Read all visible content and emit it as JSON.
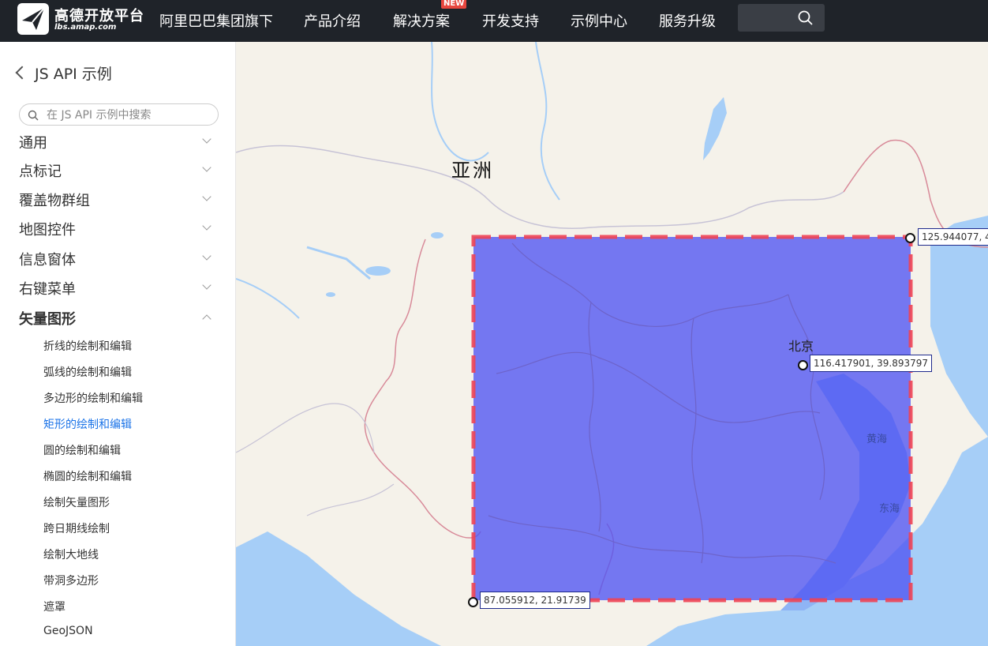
{
  "brand": {
    "title": "高德开放平台",
    "subtitle": "lbs.amap.com"
  },
  "nav": {
    "items": [
      "阿里巴巴集团旗下",
      "产品介绍",
      "解决方案",
      "开发支持",
      "示例中心",
      "服务升级"
    ],
    "badge": "NEW",
    "search_value": ""
  },
  "sidebar": {
    "back_label": "JS API 示例",
    "search_placeholder": "在 JS API 示例中搜索",
    "partial_category": "通用",
    "categories": [
      "点标记",
      "覆盖物群组",
      "地图控件",
      "信息窗体",
      "右键菜单",
      "矢量图形"
    ],
    "subitems": [
      "折线的绘制和编辑",
      "弧线的绘制和编辑",
      "多边形的绘制和编辑",
      "矩形的绘制和编辑",
      "圆的绘制和编辑",
      "椭圆的绘制和编辑",
      "绘制矢量图形",
      "跨日期线绘制",
      "绘制大地线",
      "带洞多边形",
      "遮罩",
      "GeoJSON"
    ],
    "active_subitem": "矩形的绘制和编辑"
  },
  "map": {
    "continent_label": "亚洲",
    "city_label": "北京",
    "sea_labels": [
      "黄海",
      "东海"
    ],
    "coord_northeast": "125.944077, 4",
    "coord_center": "116.417901, 39.893797",
    "coord_southwest": "87.055912, 21.91739",
    "rect_fill": "#5055f2",
    "rect_stroke": "#ee4455",
    "water_color": "#a6cef7",
    "land_color": "#f5f2ea"
  },
  "colors": {
    "nav_bg": "#1f2329",
    "active_link": "#1a73e8"
  }
}
